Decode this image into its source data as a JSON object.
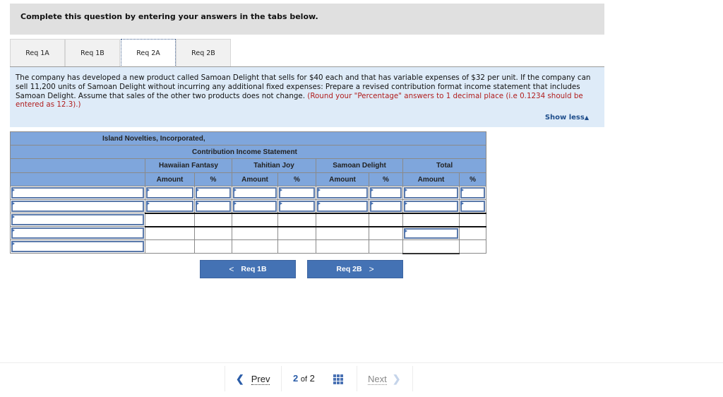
{
  "header": {
    "title": "Complete this question by entering your answers in the tabs below."
  },
  "tabs": [
    {
      "label": "Req 1A",
      "active": false
    },
    {
      "label": "Req 1B",
      "active": false
    },
    {
      "label": "Req 2A",
      "active": true
    },
    {
      "label": "Req 2B",
      "active": false
    }
  ],
  "instructions": {
    "text": "The company has developed a new product called Samoan Delight that sells for $40 each and that has variable expenses of $32 per unit. If the company can sell 11,200 units of Samoan Delight without incurring any additional fixed expenses: Prepare a revised contribution format income statement that includes Samoan Delight. Assume that sales of the other two products does not change.",
    "note": "(Round your \"Percentage\" answers to 1 decimal place (i.e 0.1234 should be entered as 12.3).)",
    "show_less_label": "Show less",
    "show_less_icon": "triangle-up-icon"
  },
  "statement": {
    "company": "Island Novelties, Incorporated,",
    "title": "Contribution Income Statement",
    "products": [
      "Hawaiian Fantasy",
      "Tahitian Joy",
      "Samoan Delight",
      "Total"
    ],
    "amount_label": "Amount",
    "percent_label": "%",
    "rows": [
      {
        "label": "",
        "values": [
          "",
          "",
          "",
          "",
          "",
          "",
          "",
          ""
        ]
      },
      {
        "label": "",
        "values": [
          "",
          "",
          "",
          "",
          "",
          "",
          "",
          ""
        ]
      },
      {
        "label": "",
        "values": [
          "",
          "",
          "",
          "",
          "",
          "",
          "",
          ""
        ]
      },
      {
        "label": "",
        "values": [
          "",
          "",
          "",
          "",
          "",
          "",
          "",
          ""
        ]
      },
      {
        "label": "",
        "values": [
          "",
          "",
          "",
          "",
          "",
          "",
          "",
          ""
        ]
      }
    ]
  },
  "nav": {
    "prev_label": "Req 1B",
    "next_label": "Req 2B",
    "prev_icon": "chevron-left-icon",
    "next_icon": "chevron-right-icon"
  },
  "pager": {
    "prev_label": "Prev",
    "next_label": "Next",
    "current": "2",
    "of_label": "of",
    "total": "2"
  }
}
